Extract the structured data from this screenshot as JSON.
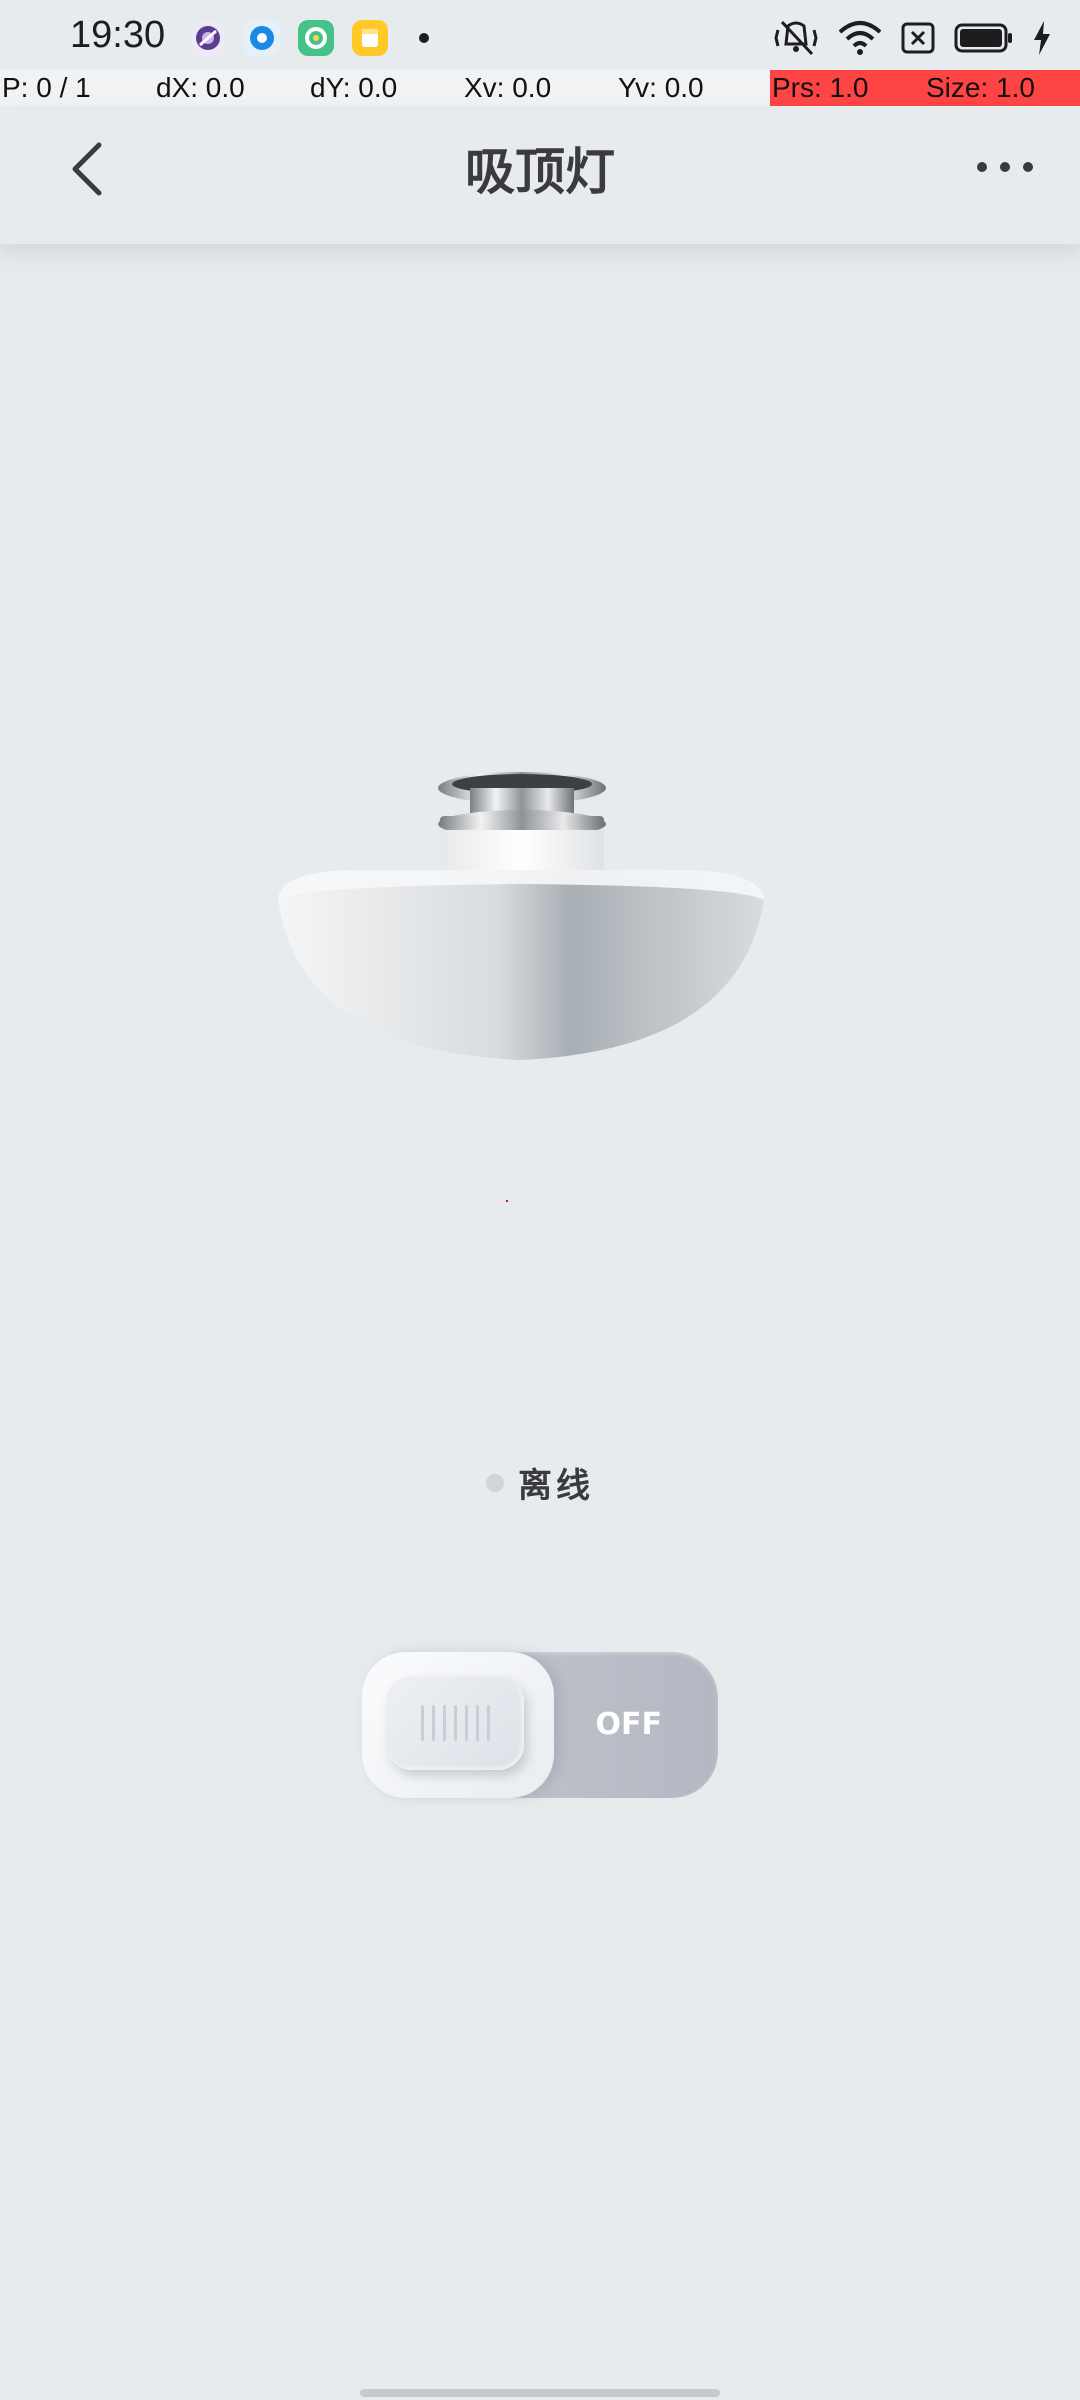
{
  "status_bar": {
    "time": "19:30",
    "notification_icons": [
      "browser-icon",
      "chat-icon",
      "app-icon",
      "notes-icon",
      "dot-icon"
    ],
    "system_icons": [
      "vibrate-off-icon",
      "wifi-icon",
      "sim-off-icon",
      "battery-icon",
      "charging-icon"
    ]
  },
  "debug": {
    "pointer": "P: 0 / 1",
    "dx": "dX: 0.0",
    "dy": "dY: 0.0",
    "xv": "Xv: 0.0",
    "yv": "Yv: 0.0",
    "prs": "Prs: 1.0",
    "size": "Size: 1.0",
    "highlight_color": "#ff4444"
  },
  "header": {
    "title": "吸顶灯",
    "back_icon": "chevron-left-icon",
    "more_icon": "more-horizontal-icon"
  },
  "device": {
    "image": "ceiling-lamp-illustration",
    "status_text": "离线",
    "status_color": "#d0d4db"
  },
  "power_toggle": {
    "label": "OFF",
    "state": "off"
  }
}
